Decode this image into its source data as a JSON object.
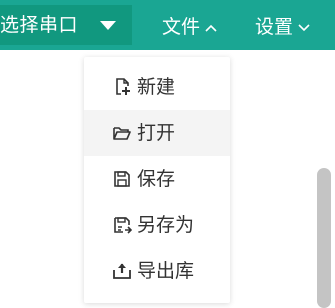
{
  "topbar": {
    "port_select": "选择串口",
    "file_menu": "文件",
    "settings_menu": "设置"
  },
  "dropdown": {
    "items": [
      {
        "label": "新建",
        "icon": "file-plus-icon"
      },
      {
        "label": "打开",
        "icon": "folder-open-icon"
      },
      {
        "label": "保存",
        "icon": "save-icon"
      },
      {
        "label": "另存为",
        "icon": "save-as-icon"
      },
      {
        "label": "导出库",
        "icon": "export-icon"
      }
    ]
  },
  "colors": {
    "topbar_bg": "#1aa693",
    "select_bg": "#11987f",
    "text": "#333333",
    "hover_bg": "#f4f4f4",
    "scrollbar": "#c4c4c4"
  }
}
